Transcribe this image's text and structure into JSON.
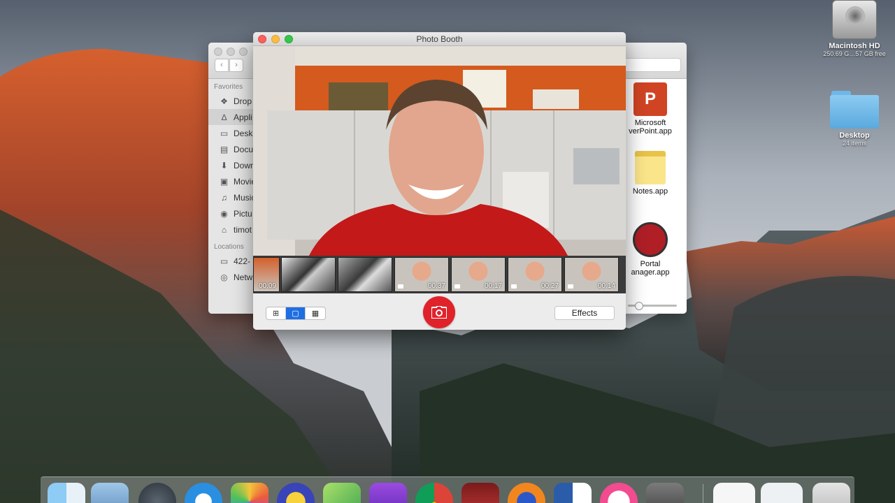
{
  "desktop": {
    "icons": [
      {
        "name": "Macintosh HD",
        "sub": "250.69 G…57 GB free"
      },
      {
        "name": "Desktop",
        "sub": "24 items"
      }
    ]
  },
  "finder": {
    "sidebar": {
      "favorites_header": "Favorites",
      "locations_header": "Locations",
      "favorites": [
        {
          "label": "Drop",
          "icon": "dropbox-icon"
        },
        {
          "label": "Appli",
          "icon": "applications-icon"
        },
        {
          "label": "Desk",
          "icon": "desktop-icon"
        },
        {
          "label": "Docu",
          "icon": "documents-icon"
        },
        {
          "label": "Down",
          "icon": "downloads-icon"
        },
        {
          "label": "Movie",
          "icon": "movies-icon"
        },
        {
          "label": "Music",
          "icon": "music-icon"
        },
        {
          "label": "Pictu",
          "icon": "pictures-icon"
        },
        {
          "label": "timot",
          "icon": "home-icon"
        }
      ],
      "locations": [
        {
          "label": "422-",
          "icon": "disk-icon"
        },
        {
          "label": "Netw",
          "icon": "network-icon"
        }
      ]
    },
    "apps": [
      {
        "line1": "Microsoft",
        "line2": "verPoint.app"
      },
      {
        "line1": "Notes.app",
        "line2": ""
      },
      {
        "line1": "Portal",
        "line2": "anager.app"
      }
    ]
  },
  "photobooth": {
    "title": "Photo Booth",
    "thumbnails": [
      {
        "duration": "00:09",
        "video": false
      },
      {
        "duration": "",
        "video": false
      },
      {
        "duration": "",
        "video": false
      },
      {
        "duration": "00:37",
        "video": true
      },
      {
        "duration": "00:17",
        "video": true
      },
      {
        "duration": "00:27",
        "video": true
      },
      {
        "duration": "00:14",
        "video": true
      }
    ],
    "view_modes": [
      "grid-view-icon",
      "single-view-icon",
      "filmstrip-view-icon"
    ],
    "effects_label": "Effects",
    "shutter_icon": "camera-icon"
  },
  "dock": {
    "items": [
      "finder-icon",
      "preview-icon",
      "launchpad-icon",
      "safari-icon",
      "photos-icon",
      "podcast-icon",
      "maps-icon",
      "imovie-icon",
      "chrome-icon",
      "photobooth-icon",
      "firefox-icon",
      "word-icon",
      "itunes-icon",
      "calculator-icon",
      "document-icon",
      "document-icon",
      "trash-icon"
    ]
  }
}
